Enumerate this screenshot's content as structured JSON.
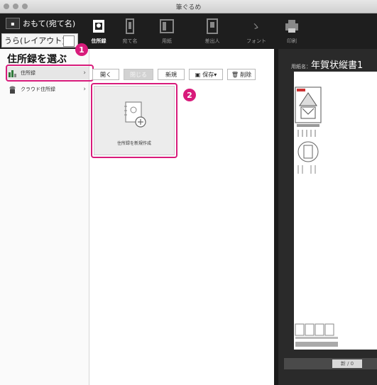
{
  "window": {
    "title": "筆ぐるめ"
  },
  "side_tabs": {
    "front_label": "おもて(宛て名)",
    "back_label": "うら(レイアウト)"
  },
  "toolbar": {
    "items": [
      {
        "label": "住所録",
        "icon": "address-book-icon",
        "active": true
      },
      {
        "label": "宛て名",
        "icon": "envelope-icon",
        "active": false
      },
      {
        "label": "用紙",
        "icon": "paper-icon",
        "active": false
      },
      {
        "label": "差出人",
        "icon": "sender-icon",
        "active": false
      },
      {
        "label": "フォント",
        "icon": "brush-icon",
        "active": false
      },
      {
        "label": "印刷",
        "icon": "printer-icon",
        "active": false
      }
    ]
  },
  "sidebar": {
    "title": "住所録を選ぶ",
    "items": [
      {
        "label": "住所録",
        "icon": "address-book-icon"
      },
      {
        "label": "クラウド住所録",
        "icon": "cloud-address-icon"
      }
    ]
  },
  "actions": {
    "open": "開く",
    "close": "閉じる",
    "new": "新規",
    "save": "保存▾",
    "delete": "削除"
  },
  "card": {
    "label": "住所録を新規作成"
  },
  "callouts": [
    "1",
    "2"
  ],
  "preview": {
    "prefix": "用紙名：",
    "name": "年賀状縦書1",
    "page": "新 / 0"
  },
  "colors": {
    "accent": "#d81b7b"
  }
}
